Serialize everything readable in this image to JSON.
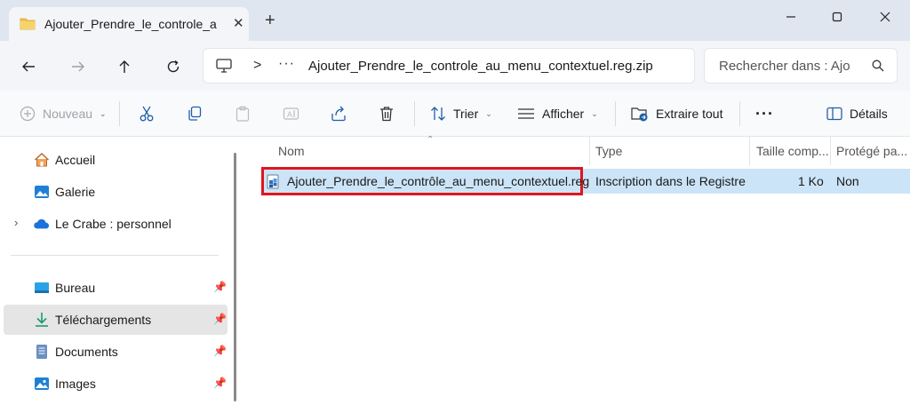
{
  "window": {
    "tab_title": "Ajouter_Prendre_le_controle_a",
    "tab_close": "✕",
    "new_tab": "+",
    "folder_color": "#f2c14e"
  },
  "address": {
    "separator": ">",
    "overflow": "···",
    "path": "Ajouter_Prendre_le_controle_au_menu_contextuel.reg.zip"
  },
  "search": {
    "placeholder": "Rechercher dans : Ajo"
  },
  "toolbar": {
    "new_label": "Nouveau",
    "sort_label": "Trier",
    "view_label": "Afficher",
    "extract_label": "Extraire tout",
    "more_label": "···",
    "details_label": "Détails"
  },
  "sidebar": {
    "items": [
      {
        "label": "Accueil",
        "icon": "home-icon"
      },
      {
        "label": "Galerie",
        "icon": "gallery-icon"
      },
      {
        "label": "Le Crabe : personnel",
        "icon": "onedrive-cloud-icon"
      },
      {
        "label": "Bureau",
        "icon": "desktop-icon"
      },
      {
        "label": "Téléchargements",
        "icon": "downloads-icon"
      },
      {
        "label": "Documents",
        "icon": "documents-icon"
      },
      {
        "label": "Images",
        "icon": "images-icon"
      }
    ]
  },
  "columns": {
    "name": "Nom",
    "type": "Type",
    "size": "Taille comp...",
    "protected": "Protégé pa..."
  },
  "files": [
    {
      "name": "Ajouter_Prendre_le_contrôle_au_menu_contextuel.reg",
      "type": "Inscription dans le Registre",
      "size": "1 Ko",
      "protected": "Non"
    }
  ],
  "colors": {
    "accent": "#0067c0",
    "selection": "#cce4f7",
    "highlight_box": "#e0141e"
  }
}
